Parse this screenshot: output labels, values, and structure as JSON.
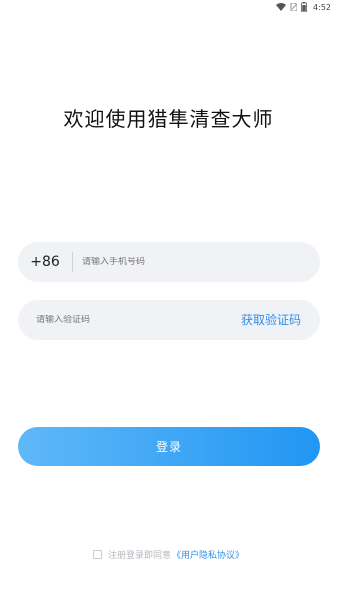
{
  "status_bar": {
    "time": "4:52",
    "icons": [
      "wifi-icon",
      "sim-icon",
      "battery-icon"
    ]
  },
  "title": "欢迎使用猎隼清查大师",
  "phone_field": {
    "country_code": "+86",
    "placeholder": "请输入手机号码",
    "value": ""
  },
  "code_field": {
    "placeholder": "请输入验证码",
    "value": "",
    "get_code_label": "获取验证码"
  },
  "login_button_label": "登录",
  "agreement": {
    "text": "注册登录即同意",
    "link_text": "《用户隐私协议》",
    "checked": false
  },
  "colors": {
    "accent": "#2f8fe9",
    "button_gradient_start": "#5fb8f8",
    "button_gradient_end": "#2196f3",
    "field_background": "#f1f2f5"
  }
}
